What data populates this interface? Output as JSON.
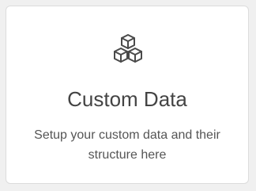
{
  "card": {
    "icon": "cubes-icon",
    "title": "Custom Data",
    "description": "Setup your custom data and their structure here"
  },
  "colors": {
    "page_background": "#f0f0f0",
    "card_background": "#ffffff",
    "card_border": "#dcdcdc",
    "title_text": "#444444",
    "description_text": "#555555",
    "icon_stroke": "#4a4a4a"
  }
}
